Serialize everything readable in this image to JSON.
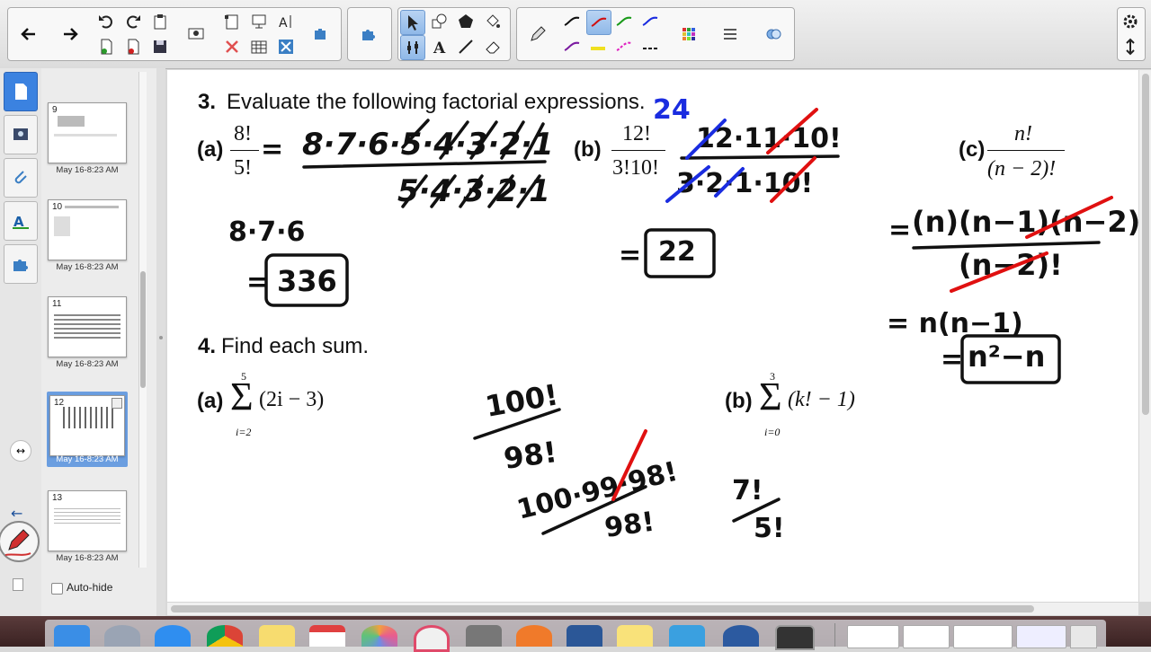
{
  "toolbar": {
    "groups": [
      "navigation",
      "page-edit",
      "add-ons",
      "drawing",
      "properties",
      "right-controls"
    ],
    "accent_color": "#8fb8e8"
  },
  "left_tabs": [
    "page-sorter",
    "gallery",
    "attachments",
    "properties",
    "add-ons"
  ],
  "sorter": {
    "pages": [
      {
        "num": "9",
        "date": "May 16-8:23 AM",
        "selected": false
      },
      {
        "num": "10",
        "date": "May 16-8:23 AM",
        "selected": false
      },
      {
        "num": "11",
        "date": "May 16-8:23 AM",
        "selected": false
      },
      {
        "num": "12",
        "date": "May 16-8:23 AM",
        "selected": true
      },
      {
        "num": "13",
        "date": "May 16-8:23 AM",
        "selected": false
      }
    ],
    "autohide_label": "Auto-hide",
    "autohide_checked": false
  },
  "page": {
    "q3_number": "3.",
    "q3_title": "Evaluate the following factorial expressions.",
    "q3a_label": "(a)",
    "q3a_num": "8!",
    "q3a_den": "5!",
    "q3b_label": "(b)",
    "q3b_num": "12!",
    "q3b_den": "3!10!",
    "q3c_label": "(c)",
    "q3c_num": "n!",
    "q3c_den": "(n − 2)!",
    "q4_number": "4.",
    "q4_title": "Find each sum.",
    "q4a_label": "(a)",
    "q4a_upper": "5",
    "q4a_lower": "i=2",
    "q4a_expr": "(2i − 3)",
    "q4b_label": "(b)",
    "q4b_upper": "3",
    "q4b_lower": "i=0",
    "q4b_expr": "(k! − 1)"
  },
  "ink": {
    "a_work": "8·7·6·5·4·3·2·1",
    "a_work_den": "5·4·3·2·1",
    "a_step": "8·7·6",
    "a_answer": "336",
    "b_note": "24",
    "b_work_num": "12·11·10!",
    "b_work_den": "3·2·1·10!",
    "b_answer": "22",
    "c_line1": "(n)(n−1)(n−2)!",
    "c_line1_den": "(n−2)!",
    "c_line2": "= n(n−1)",
    "c_answer": "n²−n",
    "sum_work1_num": "100!",
    "sum_work1_den": "98!",
    "sum_work2_num": "100·99·98!",
    "sum_work2_den": "98!",
    "sum_work3_num": "7!",
    "sum_work3_den": "5!",
    "black": "#111111",
    "blue": "#1a2ce0",
    "red": "#e01010"
  }
}
